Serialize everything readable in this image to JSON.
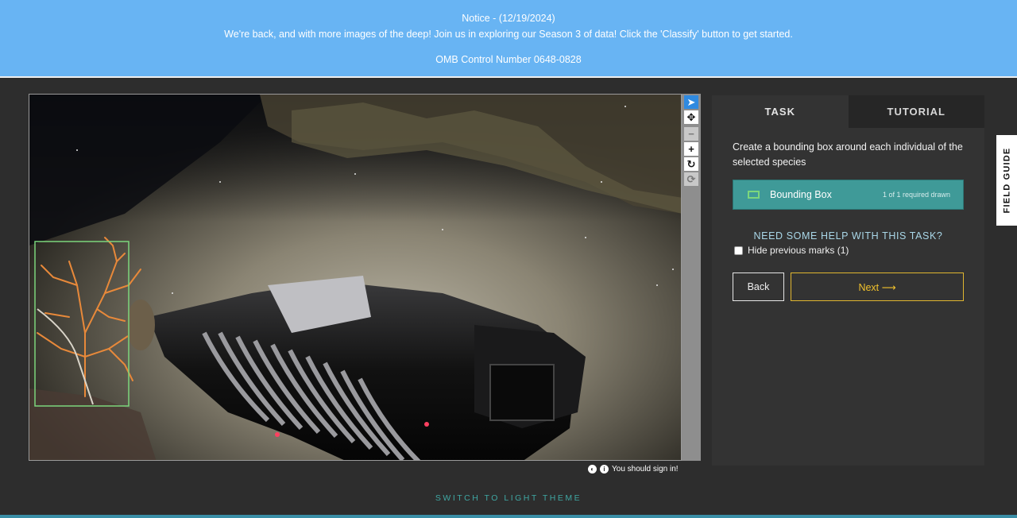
{
  "notice": {
    "title": "Notice - (12/19/2024)",
    "message": "We're back, and with more images of the deep! Join us in exploring our Season 3 of data! Click the 'Classify' button to get started.",
    "omb": "OMB Control Number 0648-0828"
  },
  "toolbar": {
    "tools": [
      {
        "name": "pointer-tool",
        "icon": "cursor-arrow-icon",
        "glyph": "➤",
        "state": "active"
      },
      {
        "name": "pan-tool",
        "icon": "move-arrows-icon",
        "glyph": "✥",
        "state": "normal"
      },
      {
        "name": "zoom-out-tool",
        "icon": "minus-icon",
        "glyph": "−",
        "state": "disabled"
      },
      {
        "name": "zoom-in-tool",
        "icon": "plus-icon",
        "glyph": "+",
        "state": "normal"
      },
      {
        "name": "rotate-tool",
        "icon": "rotate-icon",
        "glyph": "↻",
        "state": "normal"
      },
      {
        "name": "reset-tool",
        "icon": "reset-icon",
        "glyph": "⟳",
        "state": "disabled"
      }
    ]
  },
  "viewer_footer": {
    "contrast_icon": "◐",
    "info_icon": "i",
    "sign_in_text": "You should sign in!"
  },
  "panel": {
    "tabs": [
      "TASK",
      "TUTORIAL"
    ],
    "instruction": "Create a bounding box around each individual of the selected species",
    "tool_label": "Bounding Box",
    "tool_count": "1 of 1 required drawn",
    "help": "NEED SOME HELP WITH THIS TASK?",
    "hide_marks": "Hide previous marks (1)",
    "back": "Back",
    "next": "Next ⟶"
  },
  "field_guide": "FIELD GUIDE",
  "theme_switch": "SWITCH TO LIGHT THEME",
  "colors": {
    "notice_bg": "#68b4f3",
    "accent_teal": "#3f9a98",
    "next_gold": "#e0b630",
    "bbox_green": "#7cd67c"
  }
}
